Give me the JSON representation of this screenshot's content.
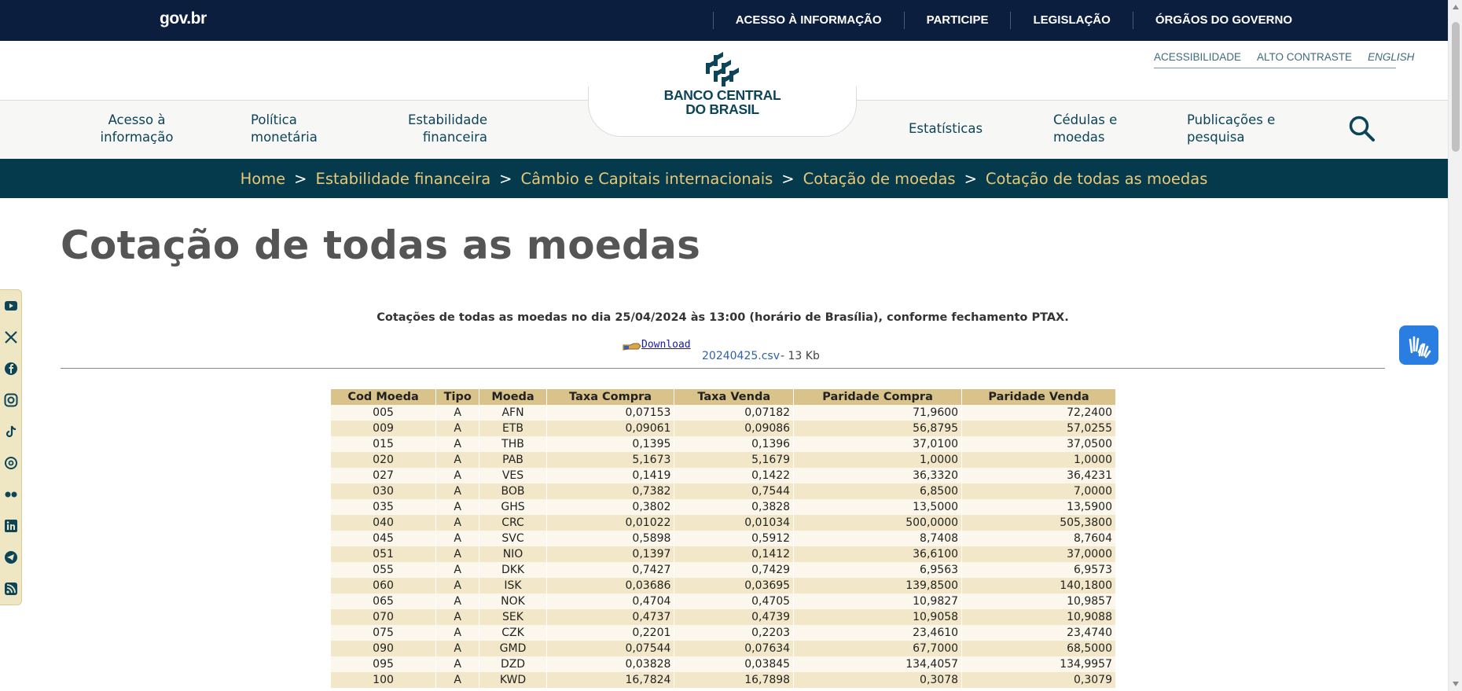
{
  "govbar": {
    "logo": "gov.br",
    "links": [
      "ACESSO À INFORMAÇÃO",
      "PARTICIPE",
      "LEGISLAÇÃO",
      "ÓRGÃOS DO GOVERNO"
    ]
  },
  "accessibility": {
    "acessibilidade": "ACESSIBILIDADE",
    "alto_contraste": "ALTO CONTRASTE",
    "english": "ENGLISH"
  },
  "logo": {
    "line1": "BANCO CENTRAL",
    "line2": "DO BRASIL"
  },
  "nav": {
    "acesso": "Acesso à informação",
    "politica": "Política monetária",
    "estabilidade": "Estabilidade financeira",
    "estatisticas": "Estatísticas",
    "cedulas": "Cédulas e moedas",
    "publicacoes": "Publicações e pesquisa",
    "search_icon": "search-icon"
  },
  "breadcrumb": [
    "Home",
    "Estabilidade financeira",
    "Câmbio e Capitais internacionais",
    "Cotação de moedas",
    "Cotação de todas as moedas"
  ],
  "breadcrumb_sep": ">",
  "title": "Cotação de todas as moedas",
  "info_text": "Cotações de todas as moedas no dia 25/04/2024 às 13:00 (horário de Brasília), conforme fechamento PTAX.",
  "download": {
    "label": "Download",
    "file": "20240425.csv",
    "size": " - 13 Kb"
  },
  "social_icons": [
    "youtube-icon",
    "x-icon",
    "facebook-icon",
    "instagram-icon",
    "tiktok-icon",
    "threads-icon",
    "flickr-icon",
    "linkedin-icon",
    "telegram-icon",
    "rss-icon"
  ],
  "colors": {
    "navy": "#0b1e3d",
    "teal": "#043a4b",
    "gold": "#e8c878",
    "header_row": "#d9c38a"
  },
  "table": {
    "headers": [
      "Cod Moeda",
      "Tipo",
      "Moeda",
      "Taxa Compra",
      "Taxa Venda",
      "Paridade Compra",
      "Paridade Venda"
    ],
    "rows": [
      [
        "005",
        "A",
        "AFN",
        "0,07153",
        "0,07182",
        "71,9600",
        "72,2400"
      ],
      [
        "009",
        "A",
        "ETB",
        "0,09061",
        "0,09086",
        "56,8795",
        "57,0255"
      ],
      [
        "015",
        "A",
        "THB",
        "0,1395",
        "0,1396",
        "37,0100",
        "37,0500"
      ],
      [
        "020",
        "A",
        "PAB",
        "5,1673",
        "5,1679",
        "1,0000",
        "1,0000"
      ],
      [
        "027",
        "A",
        "VES",
        "0,1419",
        "0,1422",
        "36,3320",
        "36,4231"
      ],
      [
        "030",
        "A",
        "BOB",
        "0,7382",
        "0,7544",
        "6,8500",
        "7,0000"
      ],
      [
        "035",
        "A",
        "GHS",
        "0,3802",
        "0,3828",
        "13,5000",
        "13,5900"
      ],
      [
        "040",
        "A",
        "CRC",
        "0,01022",
        "0,01034",
        "500,0000",
        "505,3800"
      ],
      [
        "045",
        "A",
        "SVC",
        "0,5898",
        "0,5912",
        "8,7408",
        "8,7604"
      ],
      [
        "051",
        "A",
        "NIO",
        "0,1397",
        "0,1412",
        "36,6100",
        "37,0000"
      ],
      [
        "055",
        "A",
        "DKK",
        "0,7427",
        "0,7429",
        "6,9563",
        "6,9573"
      ],
      [
        "060",
        "A",
        "ISK",
        "0,03686",
        "0,03695",
        "139,8500",
        "140,1800"
      ],
      [
        "065",
        "A",
        "NOK",
        "0,4704",
        "0,4705",
        "10,9827",
        "10,9857"
      ],
      [
        "070",
        "A",
        "SEK",
        "0,4737",
        "0,4739",
        "10,9058",
        "10,9088"
      ],
      [
        "075",
        "A",
        "CZK",
        "0,2201",
        "0,2203",
        "23,4610",
        "23,4740"
      ],
      [
        "090",
        "A",
        "GMD",
        "0,07544",
        "0,07634",
        "67,7000",
        "68,5000"
      ],
      [
        "095",
        "A",
        "DZD",
        "0,03828",
        "0,03845",
        "134,4057",
        "134,9957"
      ],
      [
        "100",
        "A",
        "KWD",
        "16,7824",
        "16,7898",
        "0,3078",
        "0,3079"
      ]
    ]
  }
}
